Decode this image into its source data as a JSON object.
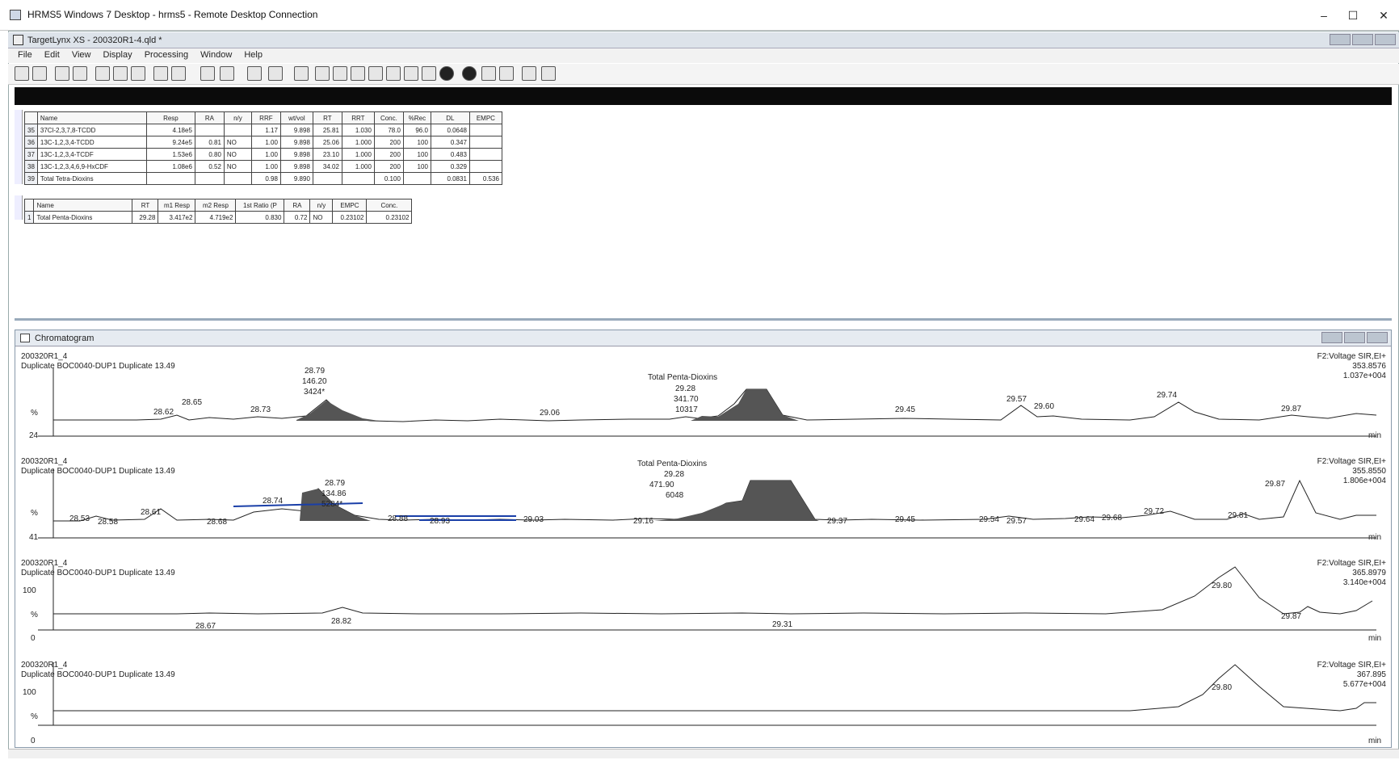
{
  "rdp": {
    "title": "HRMS5 Windows 7 Desktop - hrms5 - Remote Desktop Connection"
  },
  "app": {
    "title": "TargetLynx XS - 200320R1-4.qld *",
    "menu": [
      "File",
      "Edit",
      "View",
      "Display",
      "Processing",
      "Window",
      "Help"
    ]
  },
  "table1": {
    "headers": [
      "Name",
      "Resp",
      "RA",
      "n/y",
      "RRF",
      "wt/vol",
      "RT",
      "RRT",
      "Conc.",
      "%Rec",
      "DL",
      "EMPC"
    ],
    "rows": [
      {
        "id": "35",
        "cells": [
          "37Cl-2,3,7,8-TCDD",
          "4.18e5",
          "",
          "",
          "1.17",
          "9.898",
          "25.81",
          "1.030",
          "78.0",
          "96.0",
          "0.0648",
          ""
        ]
      },
      {
        "id": "36",
        "cells": [
          "13C-1,2,3,4-TCDD",
          "9.24e5",
          "0.81",
          "NO",
          "1.00",
          "9.898",
          "25.06",
          "1.000",
          "200",
          "100",
          "0.347",
          ""
        ]
      },
      {
        "id": "37",
        "cells": [
          "13C-1,2,3,4-TCDF",
          "1.53e6",
          "0.80",
          "NO",
          "1.00",
          "9.898",
          "23.10",
          "1.000",
          "200",
          "100",
          "0.483",
          ""
        ]
      },
      {
        "id": "38",
        "cells": [
          "13C-1,2,3,4,6,9-HxCDF",
          "1.08e6",
          "0.52",
          "NO",
          "1.00",
          "9.898",
          "34.02",
          "1.000",
          "200",
          "100",
          "0.329",
          ""
        ]
      },
      {
        "id": "39",
        "cells": [
          "Total Tetra-Dioxins",
          "",
          "",
          "",
          "0.98",
          "9.890",
          "",
          "",
          "0.100",
          "",
          "0.0831",
          "0.536"
        ]
      }
    ]
  },
  "table2": {
    "headers": [
      "Name",
      "RT",
      "m1 Resp",
      "m2 Resp",
      "1st Ratio (P",
      "RA",
      "n/y",
      "EMPC",
      "Conc."
    ],
    "rows": [
      {
        "id": "1",
        "cells": [
          "Total Penta-Dioxins",
          "29.28",
          "3.417e2",
          "4.719e2",
          "0.830",
          "0.72",
          "NO",
          "0.23102",
          "0.23102"
        ]
      }
    ]
  },
  "chromatogram": {
    "window_title": "Chromatogram",
    "traces": [
      {
        "sample": "200320R1_4",
        "desc": "Duplicate BOC0040-DUP1 Duplicate 13.49",
        "func": "F2:Voltage SIR,EI+",
        "mass": "353.8576",
        "intensity": "1.037e+004",
        "ylabel": "%",
        "ymin": "24",
        "xunit": "min",
        "peaks": [
          "28.62",
          "28.65",
          "28.73",
          "28.79",
          "146.20",
          "3424*",
          "29.06",
          "Total Penta-Dioxins",
          "29.28",
          "341.70",
          "10317",
          "29.45",
          "29.57",
          "29.60",
          "29.74",
          "29.87"
        ]
      },
      {
        "sample": "200320R1_4",
        "desc": "Duplicate BOC0040-DUP1 Duplicate 13.49",
        "func": "F2:Voltage SIR,EI+",
        "mass": "355.8550",
        "intensity": "1.806e+004",
        "ylabel": "%",
        "ymin": "41",
        "xunit": "min",
        "peaks": [
          "28.53",
          "28.58",
          "28.61",
          "28.68",
          "28.74",
          "28.79",
          "134.86",
          "5284*",
          "28.88",
          "28.93",
          "29.03",
          "Total Penta-Dioxins",
          "29.28",
          "471.90",
          "6048",
          "29.16",
          "29.37",
          "29.45",
          "29.54",
          "29.57",
          "29.64",
          "29.68",
          "29.72",
          "29.81",
          "29.87"
        ]
      },
      {
        "sample": "200320R1_4",
        "desc": "Duplicate BOC0040-DUP1 Duplicate 13.49",
        "func": "F2:Voltage SIR,EI+",
        "mass": "365.8979",
        "intensity": "3.140e+004",
        "ylabel": "%",
        "ymax": "100",
        "ymin": "0",
        "xunit": "min",
        "peaks": [
          "28.67",
          "28.82",
          "29.31",
          "29.80",
          "29.87"
        ]
      },
      {
        "sample": "200320R1_4",
        "desc": "Duplicate BOC0040-DUP1 Duplicate 13.49",
        "func": "F2:Voltage SIR,EI+",
        "mass": "367.895",
        "intensity": "5.677e+004",
        "ylabel": "%",
        "ymax": "100",
        "ymin": "0",
        "xunit": "min",
        "peaks": [
          "29.80"
        ]
      }
    ]
  },
  "window_controls": {
    "minimize": "–",
    "maximize": "☐",
    "close": "✕"
  }
}
